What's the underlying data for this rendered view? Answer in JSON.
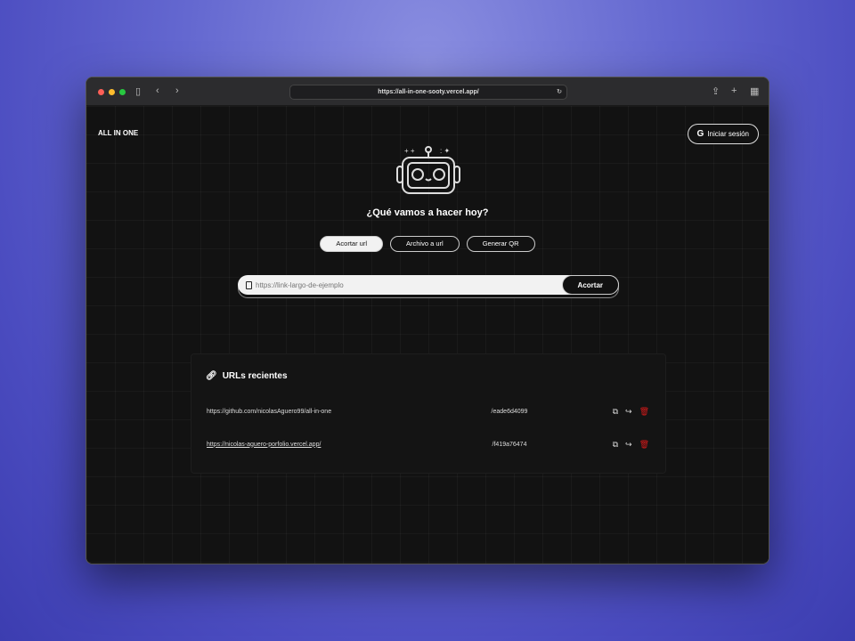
{
  "browser": {
    "url": "https://all-in-one-sooty.vercel.app/"
  },
  "header": {
    "logo": "ALL IN ONE",
    "login_label": "Iniciar sesión"
  },
  "main": {
    "title": "¿Qué vamos a hacer hoy?",
    "tabs": [
      {
        "label": "Acortar url",
        "active": true
      },
      {
        "label": "Archivo a url"
      },
      {
        "label": "Generar QR"
      }
    ],
    "input_placeholder": "https://link-largo-de-ejemplo",
    "submit_label": "Acortar"
  },
  "recent": {
    "title": "URLs recientes",
    "rows": [
      {
        "original": "https://github.com/nicolasAguero99/all-in-one",
        "short": "/eade6d4099"
      },
      {
        "original": "https://nicolas-aguero-porfolio.vercel.app/",
        "short": "/f419a76474"
      }
    ]
  },
  "colors": {
    "delete": "#d41a1a",
    "bg": "#121212"
  }
}
